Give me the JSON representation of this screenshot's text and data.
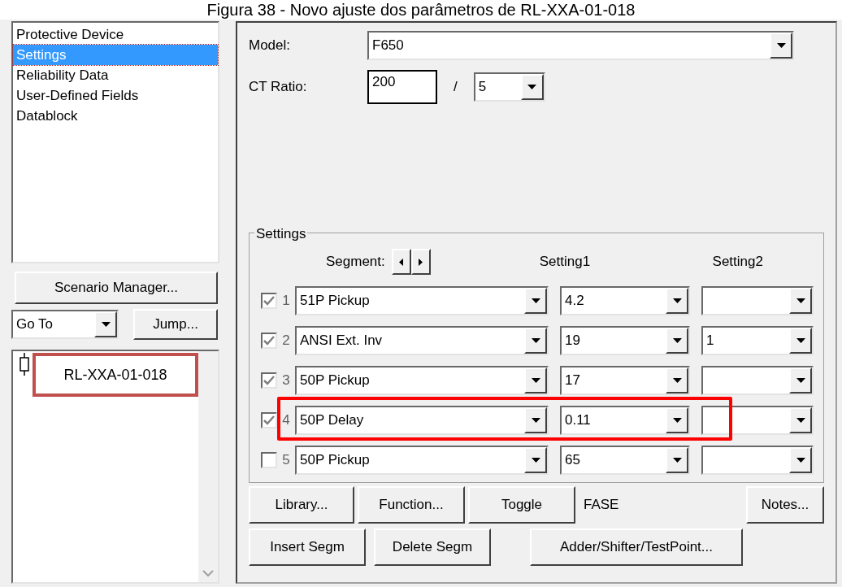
{
  "caption": "Figura 38 - Novo ajuste dos parâmetros de RL-XXA-01-018",
  "nav_list": [
    {
      "label": "Protective Device",
      "selected": false
    },
    {
      "label": "Settings",
      "selected": true
    },
    {
      "label": "Reliability Data",
      "selected": false
    },
    {
      "label": "User-Defined Fields",
      "selected": false
    },
    {
      "label": "Datablock",
      "selected": false
    }
  ],
  "scenario_button": "Scenario Manager...",
  "goto": {
    "value": "Go To"
  },
  "jump_button": "Jump...",
  "tree": [
    {
      "label": "RL-XXA-01-018",
      "highlighted": true
    }
  ],
  "model": {
    "label": "Model:",
    "value": "F650"
  },
  "ct_ratio": {
    "label": "CT Ratio:",
    "primary": "200",
    "separator": "/",
    "secondary": "5"
  },
  "settings": {
    "title": "Settings",
    "segment_label": "Segment:",
    "columns": [
      "Setting1",
      "Setting2"
    ],
    "rows": [
      {
        "checked": true,
        "number": "1",
        "segment": "51P Pickup",
        "setting1": "4.2",
        "setting2": "",
        "highlighted": false
      },
      {
        "checked": true,
        "number": "2",
        "segment": "ANSI Ext. Inv",
        "setting1": "19",
        "setting2": "1",
        "highlighted": false
      },
      {
        "checked": true,
        "number": "3",
        "segment": "50P Pickup",
        "setting1": "17",
        "setting2": "",
        "highlighted": false
      },
      {
        "checked": true,
        "number": "4",
        "segment": "50P Delay",
        "setting1": "0.11",
        "setting2": "",
        "highlighted": true
      },
      {
        "checked": false,
        "number": "5",
        "segment": "50P Pickup",
        "setting1": "65",
        "setting2": "",
        "highlighted": false
      }
    ]
  },
  "buttons_row1": [
    "Library...",
    "Function...",
    "Toggle"
  ],
  "phase_label": "FASE",
  "notes_button": "Notes...",
  "buttons_row2": [
    "Insert Segm",
    "Delete Segm",
    "Adder/Shifter/TestPoint..."
  ]
}
